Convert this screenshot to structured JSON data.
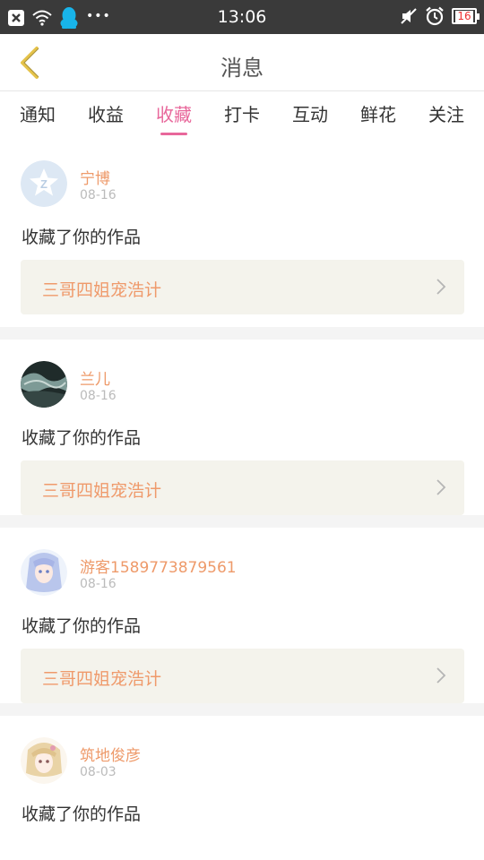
{
  "status_bar": {
    "time": "13:06",
    "battery": "16",
    "left_icons": [
      "close-notification-icon",
      "wifi-icon",
      "qq-icon",
      "more-dots-icon"
    ],
    "right_icons": [
      "mute-icon",
      "alarm-icon",
      "battery-icon"
    ]
  },
  "header": {
    "title": "消息",
    "back_icon": "chevron-left-icon"
  },
  "tabs": [
    {
      "label": "通知",
      "active": false
    },
    {
      "label": "收益",
      "active": false
    },
    {
      "label": "收藏",
      "active": true
    },
    {
      "label": "打卡",
      "active": false
    },
    {
      "label": "互动",
      "active": false
    },
    {
      "label": "鲜花",
      "active": false
    },
    {
      "label": "关注",
      "active": false
    }
  ],
  "messages": [
    {
      "username": "宁博",
      "date": "08-16",
      "action": "收藏了你的作品",
      "work": "三哥四姐宠浩计",
      "avatar": "default-avatar"
    },
    {
      "username": "兰儿",
      "date": "08-16",
      "action": "收藏了你的作品",
      "work": "三哥四姐宠浩计",
      "avatar": "photo-avatar"
    },
    {
      "username": "游客1589773879561",
      "date": "08-16",
      "action": "收藏了你的作品",
      "work": "三哥四姐宠浩计",
      "avatar": "anime-avatar"
    },
    {
      "username": "筑地俊彦",
      "date": "08-03",
      "action": "收藏了你的作品",
      "work": "",
      "avatar": "anime-avatar"
    }
  ],
  "colors": {
    "accent": "#e8679b",
    "username": "#ee9a6a",
    "work_title": "#ef9a6b",
    "work_box_bg": "#f4f3ec",
    "status_bar_bg": "#3a3a3a"
  }
}
